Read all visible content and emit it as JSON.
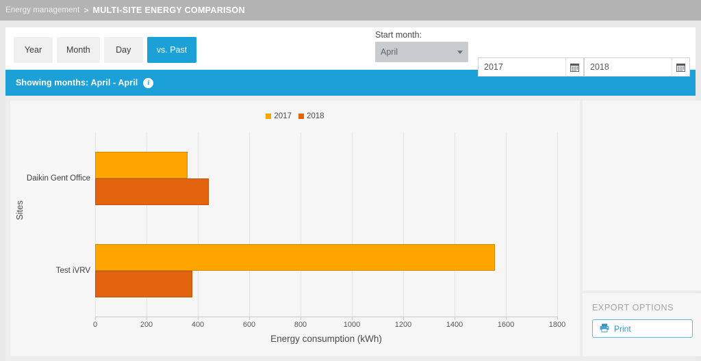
{
  "breadcrumb": {
    "parent": "Energy management",
    "separator": ">",
    "current": "MULTI-SITE ENERGY COMPARISON"
  },
  "toolbar": {
    "tabs": [
      {
        "label": "Year",
        "active": false
      },
      {
        "label": "Month",
        "active": false
      },
      {
        "label": "Day",
        "active": false
      },
      {
        "label": "vs. Past",
        "active": true
      }
    ],
    "start_month_label": "Start month:",
    "start_month_value": "April",
    "year_from": "2017",
    "year_to": "2018",
    "calendar_icon": "calendar-icon",
    "caret_icon": "chevron-down-icon"
  },
  "infobar": {
    "text": "Showing months: April - April",
    "icon": "info-icon"
  },
  "export": {
    "title": "EXPORT OPTIONS",
    "print_label": "Print",
    "print_icon": "printer-icon"
  },
  "colors": {
    "accent_blue": "#1ba0d7",
    "series_2017": "#FFA500",
    "series_2018": "#E2640F",
    "panel_bg": "#f6f6f6",
    "print_border": "#5bb9de",
    "print_text": "#3a91bf"
  },
  "chart_data": {
    "type": "bar",
    "orientation": "horizontal",
    "title": "",
    "xlabel": "Energy consumption (kWh)",
    "ylabel": "Sites",
    "categories": [
      "Daikin Gent Office",
      "Test iVRV"
    ],
    "xlim": [
      0,
      1800
    ],
    "xticks": [
      0,
      200,
      400,
      600,
      800,
      1000,
      1200,
      1400,
      1600,
      1800
    ],
    "grid": true,
    "legend_position": "top-center",
    "series": [
      {
        "name": "2017",
        "color": "#FFA500",
        "values": [
          360,
          1557
        ]
      },
      {
        "name": "2018",
        "color": "#E2640F",
        "values": [
          443,
          379
        ]
      }
    ]
  }
}
